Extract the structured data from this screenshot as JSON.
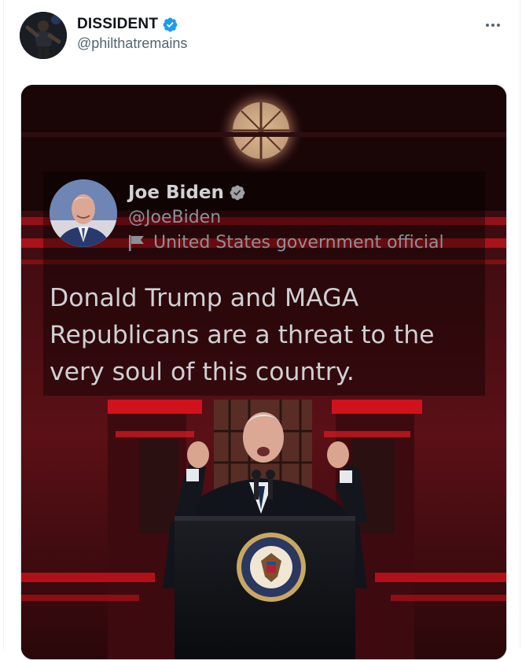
{
  "tweet": {
    "author_name": "DISSIDENT",
    "author_handle": "@philthatremains",
    "verified_icon": "verified-badge-icon",
    "more_icon": "more-options-icon"
  },
  "media": {
    "embedded_tweet": {
      "name": "Joe Biden",
      "handle": "@JoeBiden",
      "label": "United States government official",
      "text": "Donald Trump and MAGA Republicans are a threat to the very soul of this country."
    },
    "seal_text": "SEAL OF THE PRESIDENT OF THE UNITED STATES"
  },
  "colors": {
    "verified_blue": "#1d9bf0",
    "handle_gray": "#536471",
    "name_black": "#0f1419",
    "backdrop_red": "#c4141e"
  }
}
